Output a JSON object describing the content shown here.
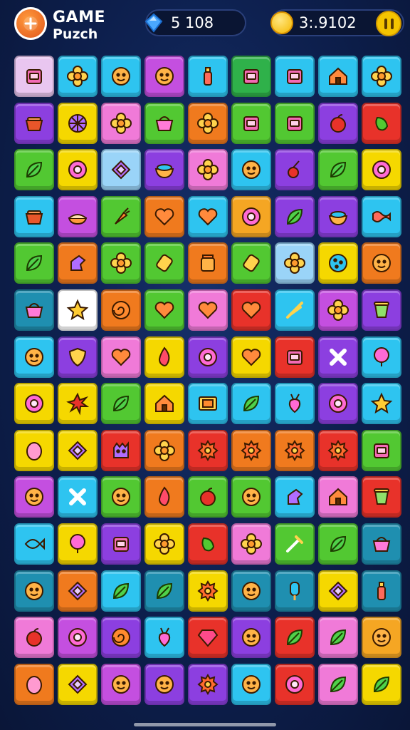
{
  "header": {
    "title_line1": "GAME",
    "title_line2": "Puzch",
    "gems": "5 108",
    "coins": "3:.9102"
  },
  "colors": {
    "background": "#0d1f4d",
    "pill_bg": "#0a1533",
    "gem": "#4aa8ff",
    "coin": "#f5c400"
  },
  "icons": {
    "logo": "logo-icon",
    "gem": "gem-icon",
    "coin": "coin-icon",
    "pause": "pause-icon"
  },
  "board": {
    "rows": 14,
    "cols": 9,
    "tiles": [
      [
        "#e9c6f0",
        "#2ec4f0",
        "#2ec4f0",
        "#c44fe0",
        "#2ec4f0",
        "#2fb14a",
        "#2ec4f0",
        "#2ec4f0",
        "#2ec4f0"
      ],
      [
        "#8c3fe0",
        "#f5d800",
        "#f07ad8",
        "#52c832",
        "#f07a1e",
        "#52c832",
        "#52c832",
        "#8c3fe0",
        "#e8322a"
      ],
      [
        "#52c832",
        "#f5d800",
        "#9ad4f8",
        "#8c3fe0",
        "#f07ad8",
        "#2ec4f0",
        "#8c3fe0",
        "#52c832",
        "#f5d800"
      ],
      [
        "#2ec4f0",
        "#c44fe0",
        "#52c832",
        "#f07a1e",
        "#2ec4f0",
        "#f5a623",
        "#8c3fe0",
        "#8c3fe0",
        "#2ec4f0"
      ],
      [
        "#52c832",
        "#f07a1e",
        "#52c832",
        "#52c832",
        "#f07a1e",
        "#52c832",
        "#9ad4f8",
        "#f5d800",
        "#f07a1e"
      ],
      [
        "#1f8fb0",
        "#ffffff",
        "#f07a1e",
        "#52c832",
        "#f07ad8",
        "#e8322a",
        "#2ec4f0",
        "#c44fe0",
        "#8c3fe0"
      ],
      [
        "#2ec4f0",
        "#8c3fe0",
        "#f07ad8",
        "#f5d800",
        "#8c3fe0",
        "#f5d800",
        "#e8322a",
        "#8c3fe0",
        "#2ec4f0"
      ],
      [
        "#f5d800",
        "#f5d800",
        "#52c832",
        "#f5d800",
        "#2ec4f0",
        "#2ec4f0",
        "#2ec4f0",
        "#8c3fe0",
        "#2ec4f0"
      ],
      [
        "#f5d800",
        "#f5d800",
        "#e8322a",
        "#f07a1e",
        "#e8322a",
        "#f07a1e",
        "#f07a1e",
        "#e8322a",
        "#52c832"
      ],
      [
        "#c44fe0",
        "#2ec4f0",
        "#52c832",
        "#f07a1e",
        "#52c832",
        "#52c832",
        "#2ec4f0",
        "#f07ad8",
        "#e8322a"
      ],
      [
        "#2ec4f0",
        "#f5d800",
        "#8c3fe0",
        "#f5d800",
        "#e8322a",
        "#f07ad8",
        "#52c832",
        "#52c832",
        "#1f8fb0"
      ],
      [
        "#1f8fb0",
        "#f07a1e",
        "#2ec4f0",
        "#1f8fb0",
        "#f5d800",
        "#1f8fb0",
        "#1f8fb0",
        "#f5d800",
        "#1f8fb0"
      ],
      [
        "#f07ad8",
        "#c44fe0",
        "#8c3fe0",
        "#2ec4f0",
        "#e8322a",
        "#8c3fe0",
        "#e8322a",
        "#f07ad8",
        "#f5a623"
      ],
      [
        "#f07a1e",
        "#f5d800",
        "#c44fe0",
        "#8c3fe0",
        "#8c3fe0",
        "#2ec4f0",
        "#e8322a",
        "#f07ad8",
        "#f5d800"
      ]
    ],
    "icon_names": [
      [
        "box-icon",
        "flower-icon",
        "face-icon",
        "face-icon",
        "bottle-icon",
        "box-icon",
        "box-icon",
        "house-icon",
        "flower-icon"
      ],
      [
        "pot-icon",
        "pizza-icon",
        "flower-icon",
        "basket-icon",
        "flower-icon",
        "box-icon",
        "box-icon",
        "apple-icon",
        "pepper-icon"
      ],
      [
        "leaf-icon",
        "ring-icon",
        "diamond-icon",
        "bowl-icon",
        "flower-icon",
        "face-icon",
        "cherry-icon",
        "leaf-icon",
        "ring-icon"
      ],
      [
        "pot-icon",
        "pie-icon",
        "carrot-icon",
        "heart-icon",
        "heart-icon",
        "ring-icon",
        "leaf-icon",
        "bowl-icon",
        "bacon-icon"
      ],
      [
        "leaf-icon",
        "hand-icon",
        "flower-icon",
        "candy-icon",
        "jar-icon",
        "candy-icon",
        "flower-icon",
        "cookie-icon",
        "face-icon"
      ],
      [
        "basket-icon",
        "star-icon",
        "swirl-icon",
        "heart-icon",
        "heart-icon",
        "heart-icon",
        "stick-icon",
        "flower-icon",
        "cup-icon"
      ],
      [
        "face-icon",
        "shield-icon",
        "heart-icon",
        "fire-icon",
        "ring-icon",
        "heart-icon",
        "box-icon",
        "cross-icon",
        "balloon-icon"
      ],
      [
        "ring-icon",
        "spike-icon",
        "leaf-icon",
        "house-icon",
        "frame-icon",
        "leaf-icon",
        "turnip-icon",
        "ring-icon",
        "star-icon"
      ],
      [
        "egg-icon",
        "diamond-icon",
        "monster-icon",
        "flower-icon",
        "gear-icon",
        "gear-icon",
        "gear-icon",
        "gear-icon",
        "box-icon"
      ],
      [
        "face-icon",
        "cross-icon",
        "face-icon",
        "fire-icon",
        "apple-icon",
        "face-icon",
        "hand-icon",
        "house-icon",
        "cup-icon"
      ],
      [
        "fish-icon",
        "balloon-icon",
        "box-icon",
        "flower-icon",
        "pepper-icon",
        "flower-icon",
        "sword-icon",
        "leaf-icon",
        "basket-icon"
      ],
      [
        "face-icon",
        "diamond-icon",
        "leaf-icon",
        "leaf-icon",
        "gear-icon",
        "face-icon",
        "popsicle-icon",
        "diamond-icon",
        "bottle-icon"
      ],
      [
        "apple-icon",
        "ring-icon",
        "swirl-icon",
        "turnip-icon",
        "gem-icon",
        "face-icon",
        "leaf-icon",
        "leaf-icon",
        "face-icon"
      ],
      [
        "egg-icon",
        "diamond-icon",
        "face-icon",
        "face-icon",
        "gear-icon",
        "face-icon",
        "ring-icon",
        "leaf-icon",
        "leaf-icon"
      ]
    ]
  }
}
